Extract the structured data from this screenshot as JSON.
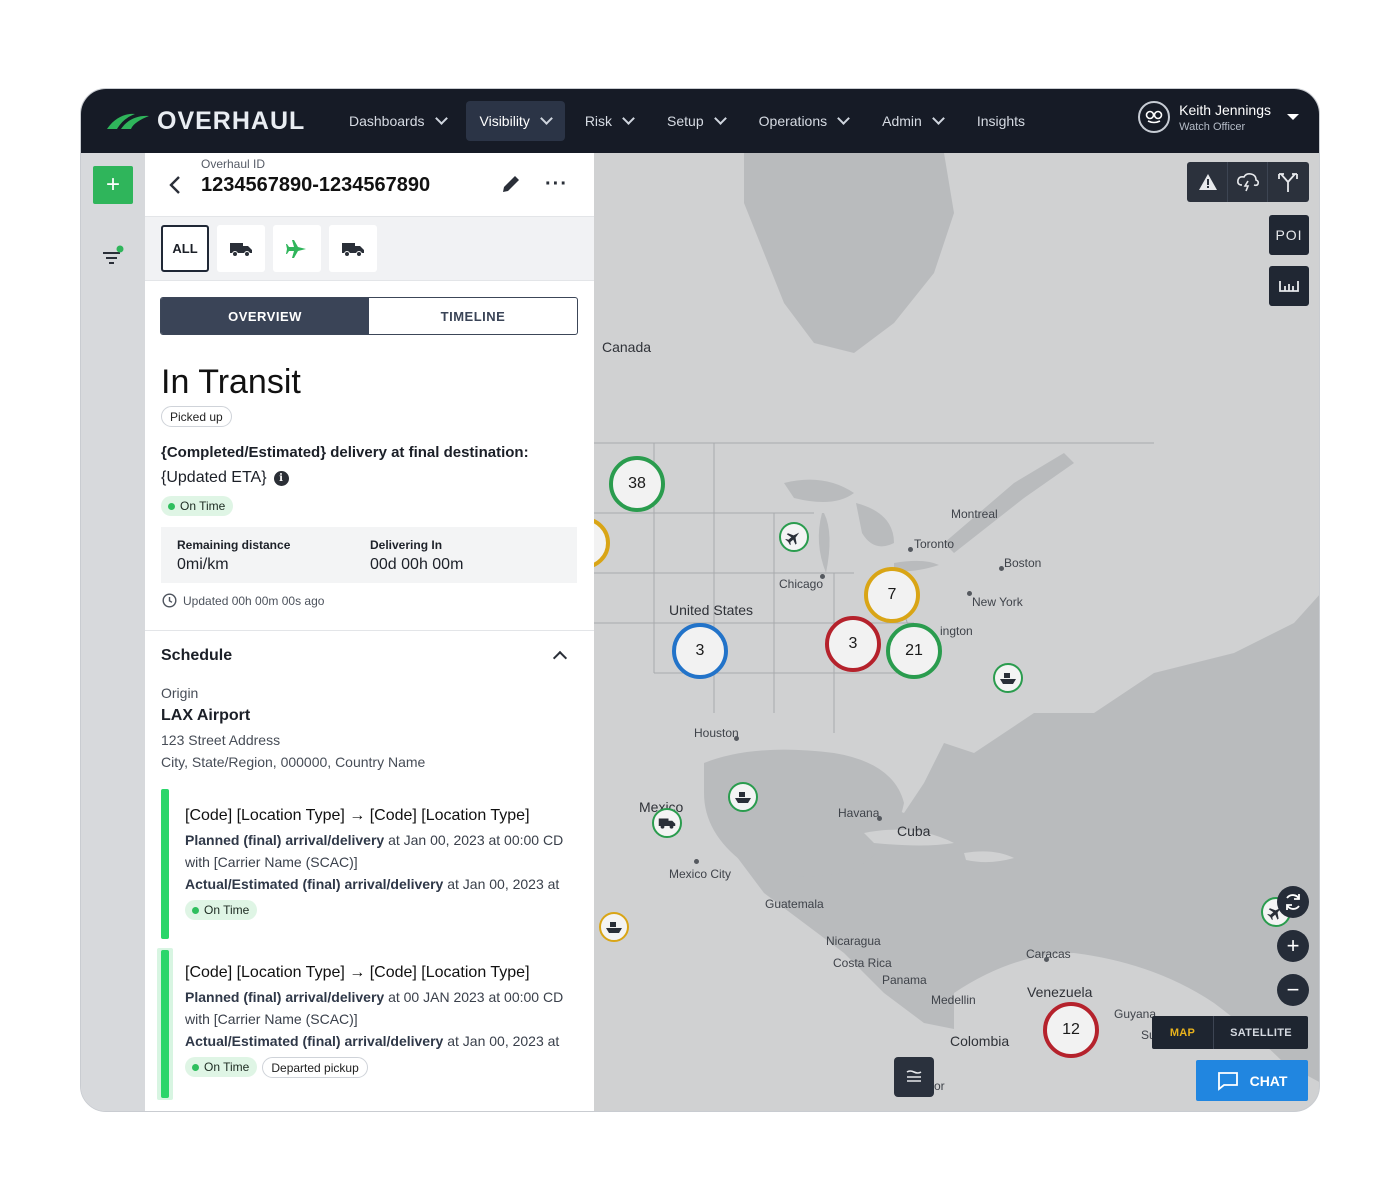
{
  "app": {
    "logo_text": "OVERHAUL"
  },
  "nav": {
    "items": [
      {
        "label": "Dashboards",
        "dropdown": true
      },
      {
        "label": "Visibility",
        "dropdown": true,
        "active": true
      },
      {
        "label": "Risk",
        "dropdown": true
      },
      {
        "label": "Setup",
        "dropdown": true
      },
      {
        "label": "Operations",
        "dropdown": true
      },
      {
        "label": "Admin",
        "dropdown": true
      },
      {
        "label": "Insights",
        "dropdown": false
      }
    ],
    "user": {
      "name": "Keith Jennings",
      "role": "Watch Officer"
    }
  },
  "panel": {
    "id_label": "Overhaul ID",
    "id_value": "1234567890-1234567890",
    "modes": [
      {
        "label": "ALL",
        "icon": "none",
        "selected": true
      },
      {
        "label": "",
        "icon": "truck-icon"
      },
      {
        "label": "",
        "icon": "airplane-icon"
      },
      {
        "label": "",
        "icon": "truck-icon"
      }
    ],
    "tabs": {
      "overview": "OVERVIEW",
      "timeline": "TIMELINE"
    },
    "status": "In Transit",
    "status_chip": "Picked up",
    "delivery_title": "{Completed/Estimated} delivery at final destination:",
    "eta": "{Updated ETA}",
    "on_time": "On Time",
    "remaining_label": "Remaining distance",
    "remaining_value": "0mi/km",
    "delivering_label": "Delivering In",
    "delivering_value": "00d 00h 00m",
    "updated": "Updated 00h 00m 00s ago",
    "schedule_title": "Schedule",
    "origin_label": "Origin",
    "origin_name": "LAX Airport",
    "origin_addr1": "123 Street Address",
    "origin_addr2": "City, State/Region, 000000, Country Name",
    "legs": [
      {
        "title": "[Code] [Location Type] → [Code] [Location Type]",
        "planned_bold": "Planned (final) arrival/delivery",
        "planned_rest": " at Jan 00, 2023 at 00:00 CD",
        "carrier": "with [Carrier Name (SCAC)]",
        "actual_bold": "Actual/Estimated (final) arrival/delivery",
        "actual_rest": " at Jan 00, 2023 at",
        "status": "On Time",
        "extra_chip": ""
      },
      {
        "title": "[Code] [Location Type] → [Code] [Location Type]",
        "planned_bold": "Planned (final) arrival/delivery",
        "planned_rest": " at 00 JAN 2023 at 00:00 CD",
        "carrier": "with [Carrier Name (SCAC)]",
        "actual_bold": "Actual/Estimated (final) arrival/delivery",
        "actual_rest": " at Jan 00, 2023 at",
        "status": "On Time",
        "extra_chip": "Departed pickup"
      }
    ]
  },
  "map": {
    "labels": [
      "Canada",
      "United States",
      "Montreal",
      "Toronto",
      "Boston",
      "New York",
      "ington",
      "Chicago",
      "Houston",
      "Mexico",
      "Mexico City",
      "Havana",
      "Cuba",
      "Guatemala",
      "Nicaragua",
      "Costa Rica",
      "Panama",
      "Caracas",
      "Venezuela",
      "Medellin",
      "Colombia",
      "Guyana",
      "Su",
      "or"
    ],
    "clusters": [
      {
        "count": "38",
        "color": "#2a9c4e"
      },
      {
        "count": "7",
        "color": "#d9a516"
      },
      {
        "count": "3",
        "color": "#2273c9"
      },
      {
        "count": "3",
        "color": "#b5222c"
      },
      {
        "count": "21",
        "color": "#2a9c4e"
      },
      {
        "count": "12",
        "color": "#b5222c"
      }
    ],
    "tools": {
      "poi": "POI"
    },
    "map_type": {
      "map": "MAP",
      "satellite": "SATELLITE",
      "active": "MAP",
      "active_color": "#e8b21c"
    },
    "chat": "CHAT"
  },
  "colors": {
    "accent": "#2fb55b",
    "nav_bg": "#161b26",
    "chat": "#2186e0"
  }
}
